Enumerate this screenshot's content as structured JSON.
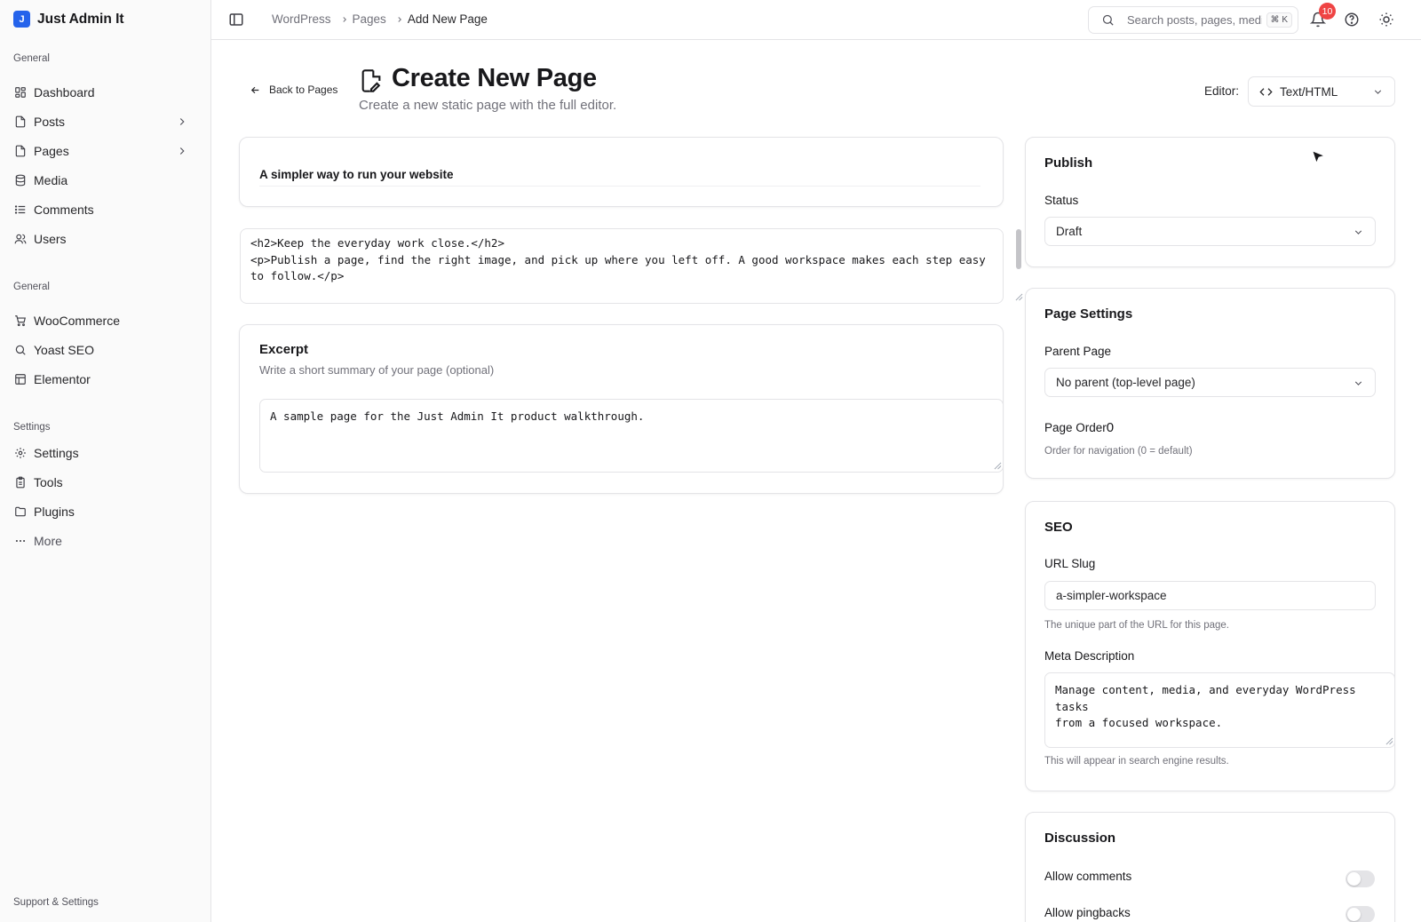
{
  "brand": {
    "initial": "J",
    "name": "Just Admin It"
  },
  "sidebar": {
    "group1_label": "General",
    "items1": [
      {
        "label": "Dashboard",
        "icon": "dashboard-icon"
      },
      {
        "label": "Posts",
        "icon": "file-icon"
      },
      {
        "label": "Pages",
        "icon": "file-icon"
      },
      {
        "label": "Media",
        "icon": "database-icon"
      },
      {
        "label": "Comments",
        "icon": "list-icon"
      },
      {
        "label": "Users",
        "icon": "users-icon"
      }
    ],
    "group2_label": "General",
    "items2": [
      {
        "label": "WooCommerce",
        "icon": "cart-icon"
      },
      {
        "label": "Yoast SEO",
        "icon": "search-icon"
      },
      {
        "label": "Elementor",
        "icon": "layout-icon"
      }
    ],
    "group3_label": "Settings",
    "items3": [
      {
        "label": "Settings",
        "icon": "gear-icon"
      },
      {
        "label": "Tools",
        "icon": "clipboard-icon"
      },
      {
        "label": "Plugins",
        "icon": "folder-icon"
      },
      {
        "label": "More",
        "icon": "ellipsis-icon"
      }
    ],
    "footer_label": "Support & Settings"
  },
  "topbar": {
    "breadcrumb": [
      "WordPress",
      "Pages",
      "Add New Page"
    ],
    "search_placeholder": "Search posts, pages, media...",
    "shortcut": "⌘ K",
    "notification_count": "10"
  },
  "header": {
    "back_label": "Back to Pages",
    "title": "Create New Page",
    "subtitle": "Create a new static page with the full editor.",
    "editor_label": "Editor:",
    "editor_value": "Text/HTML"
  },
  "content": {
    "title_value": "A simpler way to run your website",
    "body_html": "<h2>Keep the everyday work close.</h2>\n<p>Publish a page, find the right image, and pick up where you left off. A good workspace makes each step easy to follow.</p>"
  },
  "excerpt": {
    "title": "Excerpt",
    "description": "Write a short summary of your page (optional)",
    "value": "A sample page for the Just Admin It product walkthrough."
  },
  "publish": {
    "title": "Publish",
    "status_label": "Status",
    "status_value": "Draft"
  },
  "page_settings": {
    "title": "Page Settings",
    "parent_label": "Parent Page",
    "parent_value": "No parent (top-level page)",
    "order_label": "Page Order",
    "order_value": "0",
    "order_help": "Order for navigation (0 = default)"
  },
  "seo": {
    "title": "SEO",
    "slug_label": "URL Slug",
    "slug_value": "a-simpler-workspace",
    "slug_help": "The unique part of the URL for this page.",
    "meta_label": "Meta Description",
    "meta_value": "Manage content, media, and everyday WordPress tasks\nfrom a focused workspace.",
    "meta_help": "This will appear in search engine results."
  },
  "discussion": {
    "title": "Discussion",
    "allow_comments_label": "Allow comments",
    "allow_comments": false,
    "allow_pingbacks_label": "Allow pingbacks",
    "allow_pingbacks": false
  },
  "colors": {
    "brand": "#2563eb",
    "badge": "#ef4444",
    "border": "#e4e4e7"
  }
}
